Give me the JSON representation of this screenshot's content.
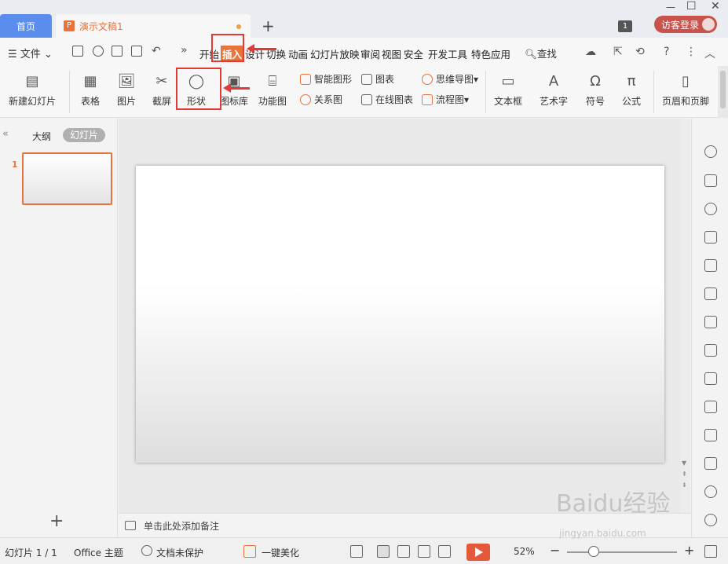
{
  "titlebar": {
    "home_tab": "首页",
    "doc_tab": "演示文稿1",
    "doc_icon": "P",
    "new_tab": "+",
    "window_count": "1",
    "login": "访客登录"
  },
  "menubar": {
    "file": "文件",
    "more": "»",
    "tabs": [
      "开始",
      "插入",
      "设计",
      "切换",
      "动画",
      "幻灯片放映",
      "审阅",
      "视图",
      "安全",
      "开发工具",
      "特色应用"
    ],
    "active_tab": "插入",
    "search": "查找"
  },
  "ribbon": {
    "new_slide": "新建幻灯片",
    "table": "表格",
    "picture": "图片",
    "screenshot": "截屏",
    "shape": "形状",
    "icon_lib": "图标库",
    "function_chart": "功能图",
    "smart_shape": "智能图形",
    "relation": "关系图",
    "chart": "图表",
    "online_chart": "在线图表",
    "mindmap": "思维导图",
    "flowchart": "流程图",
    "textbox": "文本框",
    "wordart": "艺术字",
    "symbol": "符号",
    "formula": "公式",
    "header_footer": "页眉和页脚"
  },
  "leftpanel": {
    "outline_tab": "大纲",
    "slides_tab": "幻灯片",
    "slide_number": "1",
    "add": "+"
  },
  "notes": {
    "placeholder": "单击此处添加备注"
  },
  "statusbar": {
    "slide_info": "幻灯片 1 / 1",
    "theme": "Office 主题",
    "protection": "文档未保护",
    "beautify": "一键美化",
    "zoom": "52%"
  },
  "watermark": {
    "text": "Baidu经验",
    "sub": "jingyan.baidu.com"
  },
  "colors": {
    "accent": "#e8743b",
    "home_tab": "#5b8def",
    "annotation": "#e53935",
    "login": "#c9534b"
  }
}
